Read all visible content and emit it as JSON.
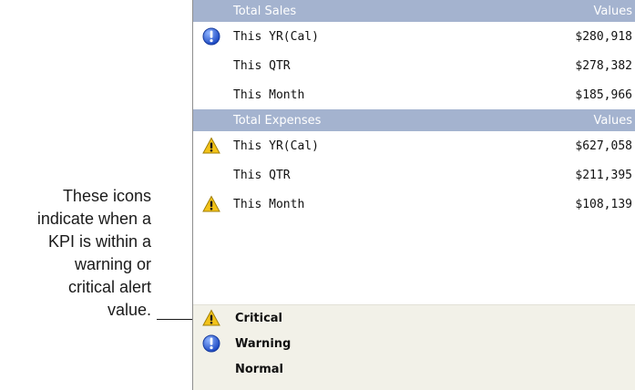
{
  "callout": {
    "lines": [
      "These icons",
      "indicate when a",
      "KPI is within a",
      "warning or",
      "critical alert",
      "value."
    ]
  },
  "sales": {
    "header_label": "Total Sales",
    "header_values": "Values",
    "rows": [
      {
        "label": "This YR(Cal)",
        "value": "$280,918",
        "icon": "warning-info-icon"
      },
      {
        "label": "This QTR",
        "value": "$278,382",
        "icon": ""
      },
      {
        "label": "This Month",
        "value": "$185,966",
        "icon": ""
      }
    ]
  },
  "expenses": {
    "header_label": "Total Expenses",
    "header_values": "Values",
    "rows": [
      {
        "label": "This YR(Cal)",
        "value": "$627,058",
        "icon": "critical-alert-icon"
      },
      {
        "label": "This QTR",
        "value": "$211,395",
        "icon": ""
      },
      {
        "label": "This Month",
        "value": "$108,139",
        "icon": "critical-alert-icon"
      }
    ]
  },
  "legend": {
    "critical": "Critical",
    "warning": "Warning",
    "normal": "Normal"
  },
  "colors": {
    "header_bg": "#a4b3cf",
    "legend_bg": "#f2f1e8",
    "warning_blue": "#2b5fd0",
    "critical_yellow": "#f3c319"
  }
}
